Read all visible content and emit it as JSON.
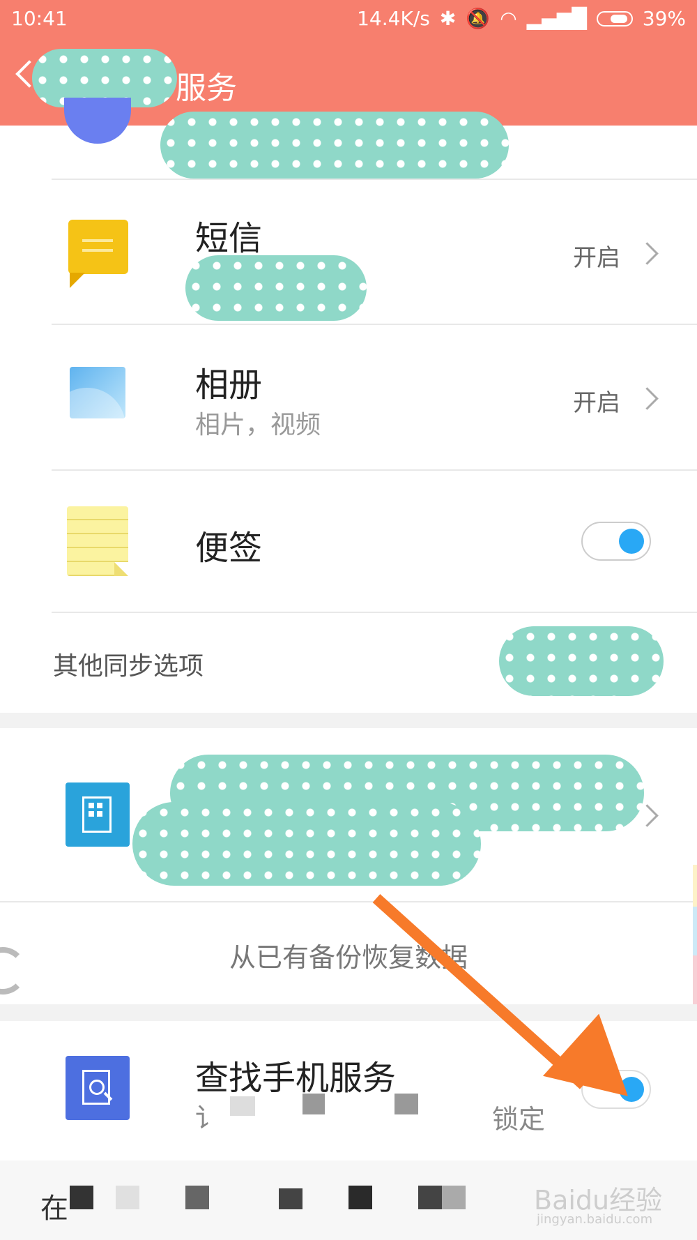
{
  "status_bar": {
    "time": "10:41",
    "speed": "14.4K/s",
    "battery": "39%"
  },
  "header": {
    "title": "服务"
  },
  "items": [
    {
      "title": "短信",
      "status": "开启"
    },
    {
      "title": "相册",
      "subtitle": "相片，视频",
      "status": "开启"
    },
    {
      "title": "便签",
      "toggle": "on"
    }
  ],
  "other_sync": "其他同步选项",
  "restore": "从已有备份恢复数据",
  "find_phone": {
    "title": "查找手机服务",
    "toggle": "on"
  },
  "watermark": {
    "brand": "Baidu经验",
    "url": "jingyan.baidu.com"
  },
  "colors": {
    "header": "#f77f6e",
    "toggle_on": "#29a8f5",
    "arrow": "#f77a2a"
  }
}
